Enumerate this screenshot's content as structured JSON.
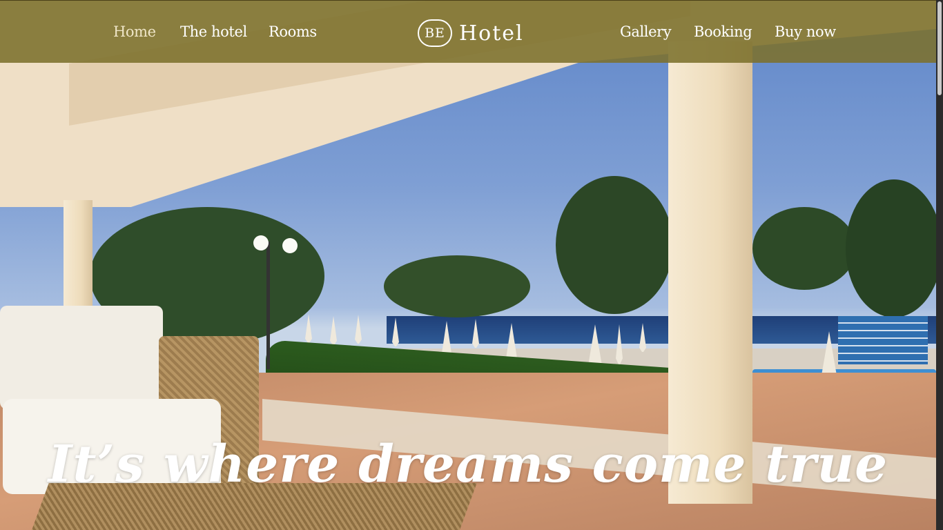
{
  "nav": {
    "left_items": [
      "Home",
      "The hotel",
      "Rooms"
    ],
    "right_items": [
      "Gallery",
      "Booking",
      "Buy now"
    ],
    "active": "Home"
  },
  "logo": {
    "mark": "BE",
    "text": "Hotel"
  },
  "hero": {
    "tagline": "It’s where dreams come true"
  },
  "colors": {
    "nav_bg": "#7c712c",
    "text": "#ffffff",
    "accent": "#efe6c8"
  }
}
